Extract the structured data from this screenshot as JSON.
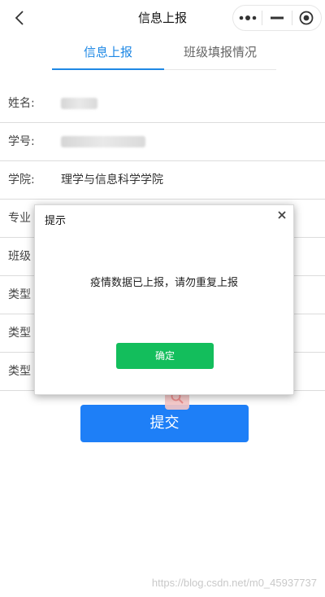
{
  "navbar": {
    "title": "信息上报",
    "back_icon": "chevron-left-icon",
    "menu_icon": "more-dots-icon",
    "minimize_icon": "minus-icon",
    "close_icon": "target-circle-icon"
  },
  "tabs": [
    {
      "label": "信息上报",
      "active": true
    },
    {
      "label": "班级填报情况",
      "active": false
    }
  ],
  "form": {
    "rows": [
      {
        "label": "姓名:",
        "value": ""
      },
      {
        "label": "学号:",
        "value": ""
      },
      {
        "label": "学院:",
        "value": "理学与信息科学学院"
      },
      {
        "label": "专业",
        "value": ""
      },
      {
        "label": "班级",
        "value": ""
      },
      {
        "label": "类型",
        "value": ""
      },
      {
        "label": "类型",
        "value": ""
      },
      {
        "label": "类型",
        "value": ""
      }
    ]
  },
  "submit": {
    "label": "提交"
  },
  "dialog": {
    "title": "提示",
    "message": "疫情数据已上报，请勿重复上报",
    "ok_label": "确定"
  },
  "watermark": "https://blog.csdn.net/m0_45937737",
  "colors": {
    "accent": "#1e88e5",
    "submit": "#1e7ff7",
    "ok": "#13be5c"
  }
}
